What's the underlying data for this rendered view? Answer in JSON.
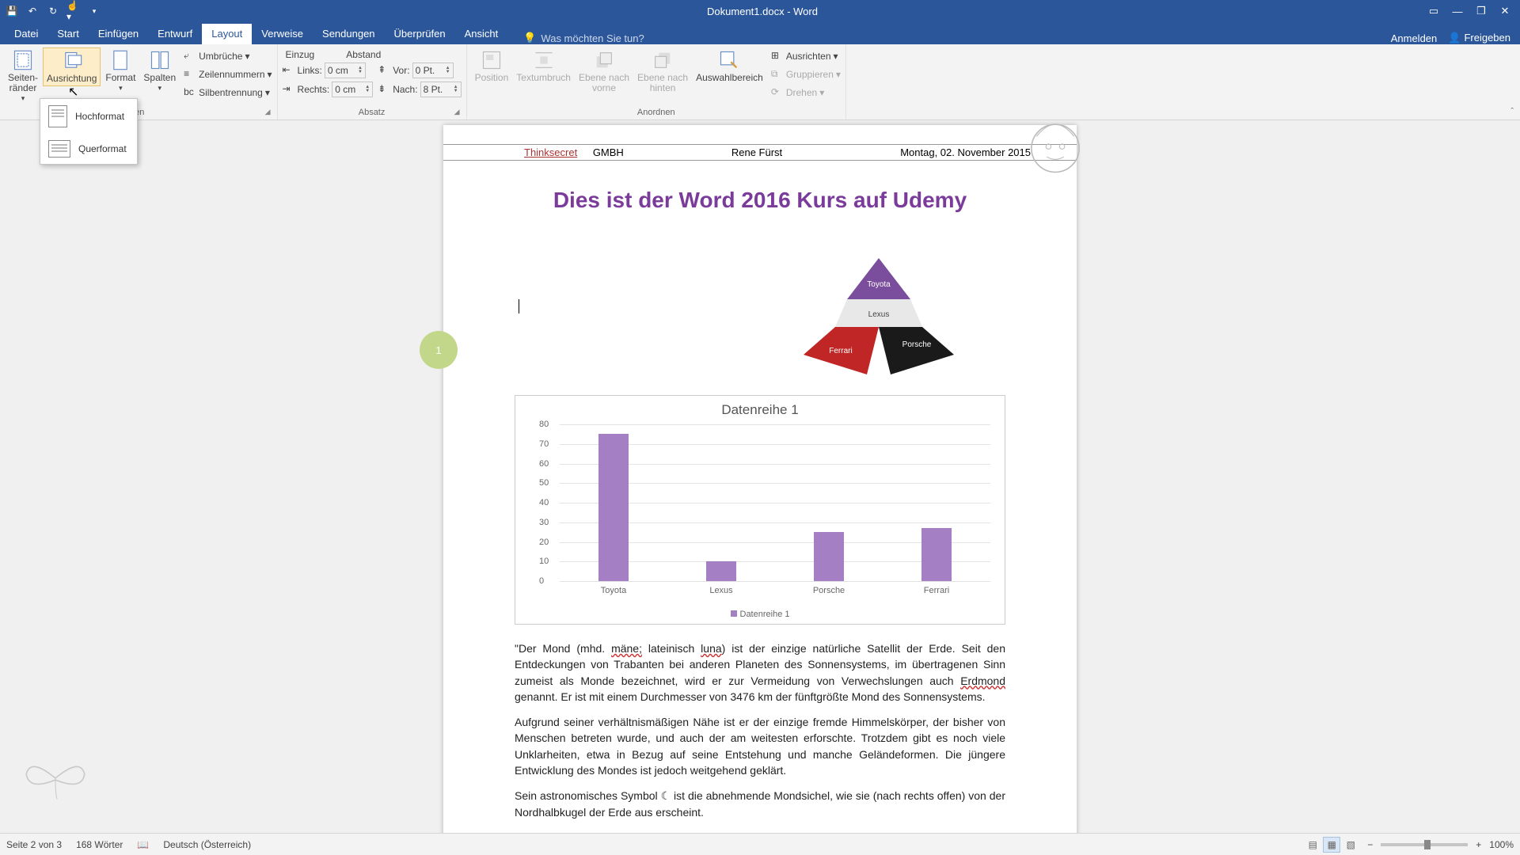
{
  "window": {
    "title": "Dokument1.docx - Word"
  },
  "qat": {
    "save": "💾",
    "undo": "↶",
    "redo": "↻",
    "touch": "☝"
  },
  "tabs": {
    "datei": "Datei",
    "start": "Start",
    "einfuegen": "Einfügen",
    "entwurf": "Entwurf",
    "layout": "Layout",
    "verweise": "Verweise",
    "sendungen": "Sendungen",
    "ueberpruefen": "Überprüfen",
    "ansicht": "Ansicht"
  },
  "tellme_placeholder": "Was möchten Sie tun?",
  "account": {
    "anmelden": "Anmelden",
    "freigeben": "Freigeben"
  },
  "ribbon": {
    "pagesetup": {
      "raender": "Seiten-\nränder",
      "ausrichtung": "Ausrichtung",
      "format": "Format",
      "spalten": "Spalten",
      "umbrueche": "Umbrüche",
      "zeilennummern": "Zeilennummern",
      "silbentrennung": "Silbentrennung",
      "group": "ten"
    },
    "absatz": {
      "einzug": "Einzug",
      "abstand": "Abstand",
      "links": "Links:",
      "rechts": "Rechts:",
      "vor": "Vor:",
      "nach": "Nach:",
      "v_links": "0  cm",
      "v_rechts": "0  cm",
      "v_vor": "0 Pt.",
      "v_nach": "8 Pt.",
      "group": "Absatz"
    },
    "anordnen": {
      "position": "Position",
      "textumbruch": "Textumbruch",
      "ebenevorne": "Ebene nach\nvorne",
      "ebenehinten": "Ebene nach\nhinten",
      "auswahl": "Auswahlbereich",
      "ausrichten": "Ausrichten",
      "gruppieren": "Gruppieren",
      "drehen": "Drehen",
      "group": "Anordnen"
    }
  },
  "orient_menu": {
    "hoch": "Hochformat",
    "quer": "Querformat"
  },
  "doc": {
    "hdr_company_a": "Thinksecret",
    "hdr_company_b": " GMBH",
    "hdr_name": "Rene Fürst",
    "hdr_date": "Montag, 02. November 2015",
    "title": "Dies ist der Word 2016 Kurs auf Udemy",
    "orb": "1",
    "pyramid": {
      "top": "Toyota",
      "mid": "Lexus",
      "left": "Ferrari",
      "right": "Porsche"
    },
    "para1_a": "\"Der Mond (mhd. ",
    "para1_b": "mäne;",
    "para1_c": " lateinisch ",
    "para1_d": "luna",
    "para1_e": ") ist der einzige natürliche Satellit der Erde. Seit den Entdeckungen von Trabanten bei anderen Planeten des Sonnensystems, im übertragenen Sinn zumeist als Monde bezeichnet, wird er zur Vermeidung von Verwechslungen auch ",
    "para1_f": "Erdmond",
    "para1_g": " genannt. Er ist mit einem Durchmesser von 3476 km der fünftgrößte Mond des Sonnensystems.",
    "para2": "Aufgrund seiner verhältnismäßigen Nähe ist er der einzige fremde Himmelskörper, der bisher von Menschen betreten wurde, und auch der am weitesten erforschte. Trotzdem gibt es noch viele Unklarheiten, etwa in Bezug auf seine Entstehung und manche Geländeformen. Die jüngere Entwicklung des Mondes ist jedoch weitgehend geklärt.",
    "para3": "Sein astronomisches Symbol ☾ ist die abnehmende Mondsichel, wie sie (nach rechts offen) von der Nordhalbkugel der Erde aus erscheint."
  },
  "chart_data": {
    "type": "bar",
    "title": "Datenreihe 1",
    "categories": [
      "Toyota",
      "Lexus",
      "Porsche",
      "Ferrari"
    ],
    "values": [
      75,
      10,
      25,
      27
    ],
    "ylim": [
      0,
      80
    ],
    "ystep": 10,
    "legend": "Datenreihe 1",
    "color": "#a57fc4"
  },
  "status": {
    "page": "Seite 2 von 3",
    "words": "168 Wörter",
    "lang": "Deutsch (Österreich)",
    "zoom": "100%"
  }
}
